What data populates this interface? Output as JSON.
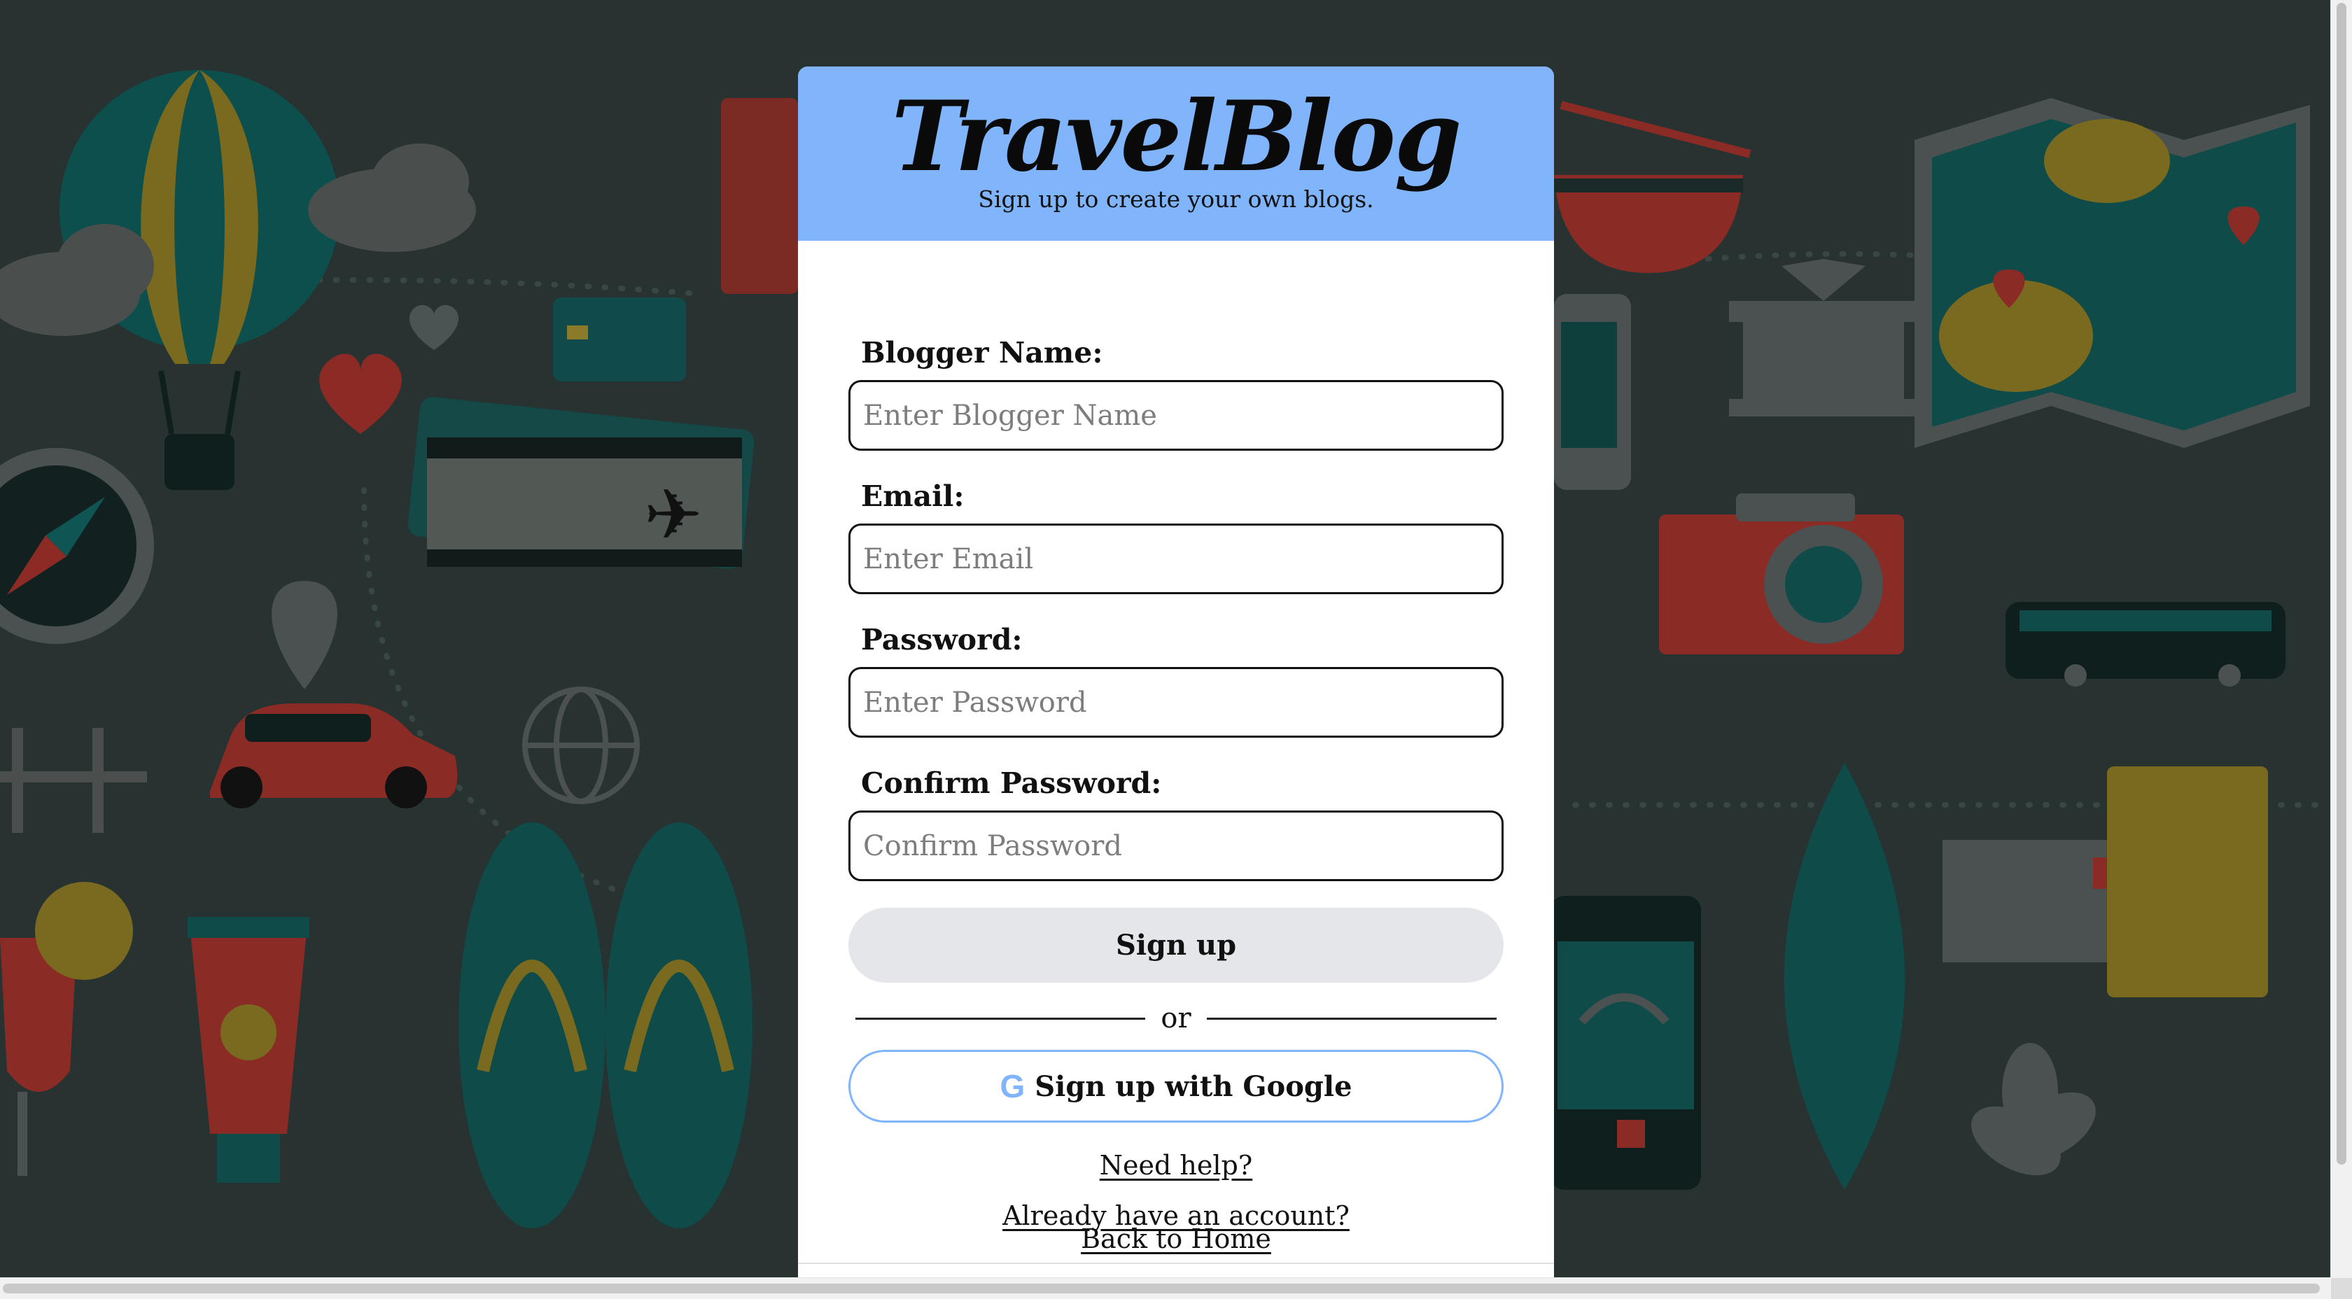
{
  "header": {
    "brand": "TravelBlog",
    "tagline": "Sign up to create your own blogs."
  },
  "form": {
    "blogger_name": {
      "label": "Blogger Name:",
      "placeholder": "Enter Blogger Name",
      "value": ""
    },
    "email": {
      "label": "Email:",
      "placeholder": "Enter Email",
      "value": ""
    },
    "password": {
      "label": "Password:",
      "placeholder": "Enter Password",
      "value": ""
    },
    "confirm_password": {
      "label": "Confirm Password:",
      "placeholder": "Confirm Password",
      "value": ""
    }
  },
  "actions": {
    "signup_label": "Sign up",
    "or_text": "or",
    "google_label": "Sign up with Google",
    "google_icon": "google-g-icon"
  },
  "links": {
    "help": "Need help?",
    "have_account": "Already have an account?",
    "back_home": "Back to Home"
  },
  "colors": {
    "header_bg": "#80b4fb",
    "page_bg": "#273231",
    "signup_button_bg": "#e4e6ea",
    "google_border": "#80b4fb"
  }
}
